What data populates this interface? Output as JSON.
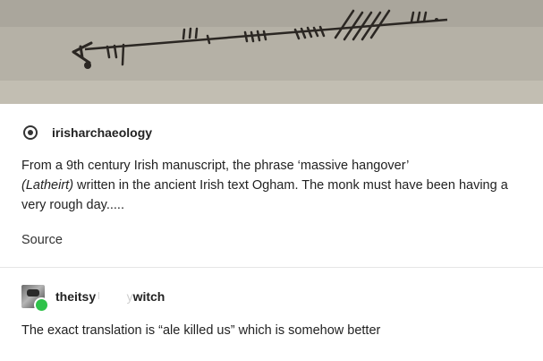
{
  "image": {
    "description_icon": "ogham-manuscript-image"
  },
  "post": {
    "username": "irisharchaeology",
    "text_part1": "From a 9th century Irish manuscript, the phrase ‘massive hangover’",
    "text_italic": "(Latheirt)",
    "text_part2": " written in the ancient Irish text Ogham. The monk must have been having a very rough day.....",
    "source_label": "Source"
  },
  "reblog": {
    "username": "theitsy",
    "username_faded": "l",
    "second_name_faded": "y",
    "second_name": "witch",
    "text": "The exact translation is “ale killed us” which is somehow better"
  }
}
